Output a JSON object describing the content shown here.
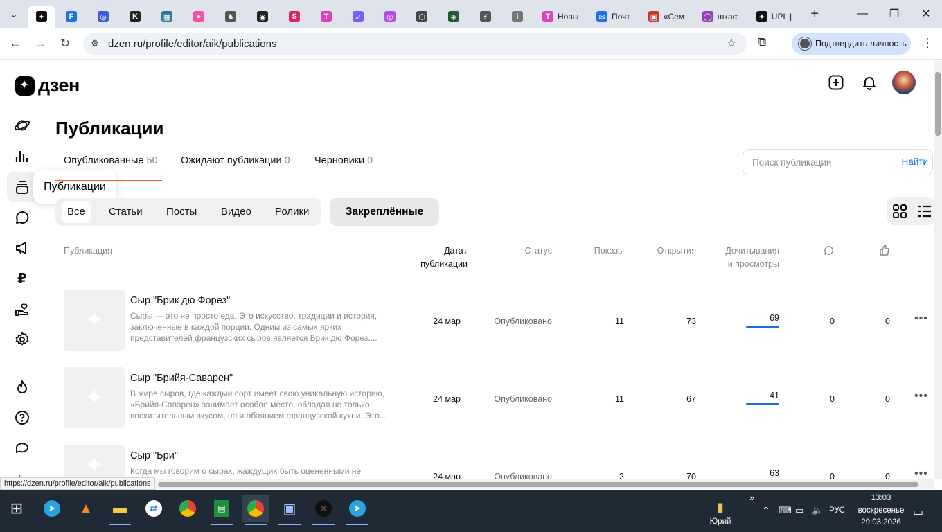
{
  "browser": {
    "tabs": [
      {
        "label": "",
        "color": "#111111",
        "glyph": "✦",
        "active": true
      },
      {
        "label": "",
        "color": "#1a73e8",
        "glyph": "F"
      },
      {
        "label": "",
        "color": "#3b5bdb",
        "glyph": "◎"
      },
      {
        "label": "",
        "color": "#222222",
        "glyph": "K"
      },
      {
        "label": "",
        "color": "#2c7a9b",
        "glyph": "▦"
      },
      {
        "label": "",
        "color": "#ff4fa3",
        "glyph": "●"
      },
      {
        "label": "",
        "color": "#555555",
        "glyph": "♞"
      },
      {
        "label": "",
        "color": "#222222",
        "glyph": "◉"
      },
      {
        "label": "",
        "color": "#e0245e",
        "glyph": "S"
      },
      {
        "label": "",
        "color": "#e03fb7",
        "glyph": "T"
      },
      {
        "label": "",
        "color": "#7b5cff",
        "glyph": "➶"
      },
      {
        "label": "",
        "color": "#b14ee8",
        "glyph": "◎"
      },
      {
        "label": "",
        "color": "#444444",
        "glyph": "⬡"
      },
      {
        "label": "",
        "color": "#1d5d3a",
        "glyph": "◈"
      },
      {
        "label": "",
        "color": "#555555",
        "glyph": "⚡"
      },
      {
        "label": "",
        "color": "#777777",
        "glyph": "i"
      },
      {
        "label": "Новы",
        "color": "#e03fb7",
        "glyph": "T"
      },
      {
        "label": "Почт",
        "color": "#1a73e8",
        "glyph": "✉"
      },
      {
        "label": "«Сем",
        "color": "#c0392b",
        "glyph": "▣"
      },
      {
        "label": "шкаф",
        "color": "#8e44ad",
        "glyph": "◯"
      },
      {
        "label": "UPL |",
        "color": "#111111",
        "glyph": "✦"
      }
    ],
    "url": "dzen.ru/profile/editor/aik/publications",
    "verify_label": "Подтвердить личность",
    "status_url": "https://dzen.ru/profile/editor/aik/publications"
  },
  "header": {
    "logo_text": "дзен"
  },
  "sidebar": {
    "tooltip": "Публикации"
  },
  "page": {
    "title": "Публикации",
    "tabs": [
      {
        "label": "Опубликованные",
        "count": "50"
      },
      {
        "label": "Ожидают публикации",
        "count": "0"
      },
      {
        "label": "Черновики",
        "count": "0"
      }
    ],
    "search_placeholder": "Поиск публикации",
    "search_button": "Найти",
    "filters": [
      "Все",
      "Статьи",
      "Посты",
      "Видео",
      "Ролики"
    ],
    "pinned_label": "Закреплённые"
  },
  "table": {
    "headers": {
      "publication": "Публикация",
      "date_line1": "Дата",
      "date_arrow": "↓",
      "date_line2": "публикации",
      "status": "Статус",
      "impressions": "Показы",
      "opens": "Открытия",
      "reads_line1": "Дочитывания",
      "reads_line2": "и просмотры"
    },
    "rows": [
      {
        "title": "Сыр \"Брик дю Форез\"",
        "description": "Сыры — это не просто еда. Это искусство, традиции и история, заключенные в каждой порции. Одним из самых ярких представителей французских сыров является Брик дю Форез....",
        "date": "24 мар",
        "status": "Опубликовано",
        "impressions": "11",
        "opens": "73",
        "reads": "69",
        "comments": "0",
        "likes": "0"
      },
      {
        "title": "Сыр \"Брийя-Саварен\"",
        "description": "В мире сыров, где каждый сорт имеет свою уникальную историю, «Брийя-Саварен» занимает особое место, обладая не только восхитительным вкусом, но и обаянием французской кухни. Это...",
        "date": "24 мар",
        "status": "Опубликовано",
        "impressions": "11",
        "opens": "67",
        "reads": "41",
        "comments": "0",
        "likes": "0"
      },
      {
        "title": "Сыр \"Бри\"",
        "description": "Когда мы говорим о сырах, жаждущих быть оцененными не",
        "date": "24 мар",
        "status": "Опубликовано",
        "impressions": "2",
        "opens": "70",
        "reads": "63",
        "comments": "0",
        "likes": "0"
      }
    ]
  },
  "taskbar": {
    "user": "Юрий",
    "lang": "РУС",
    "time": "13:03",
    "day": "воскресенье",
    "date": "29.03.2026"
  }
}
